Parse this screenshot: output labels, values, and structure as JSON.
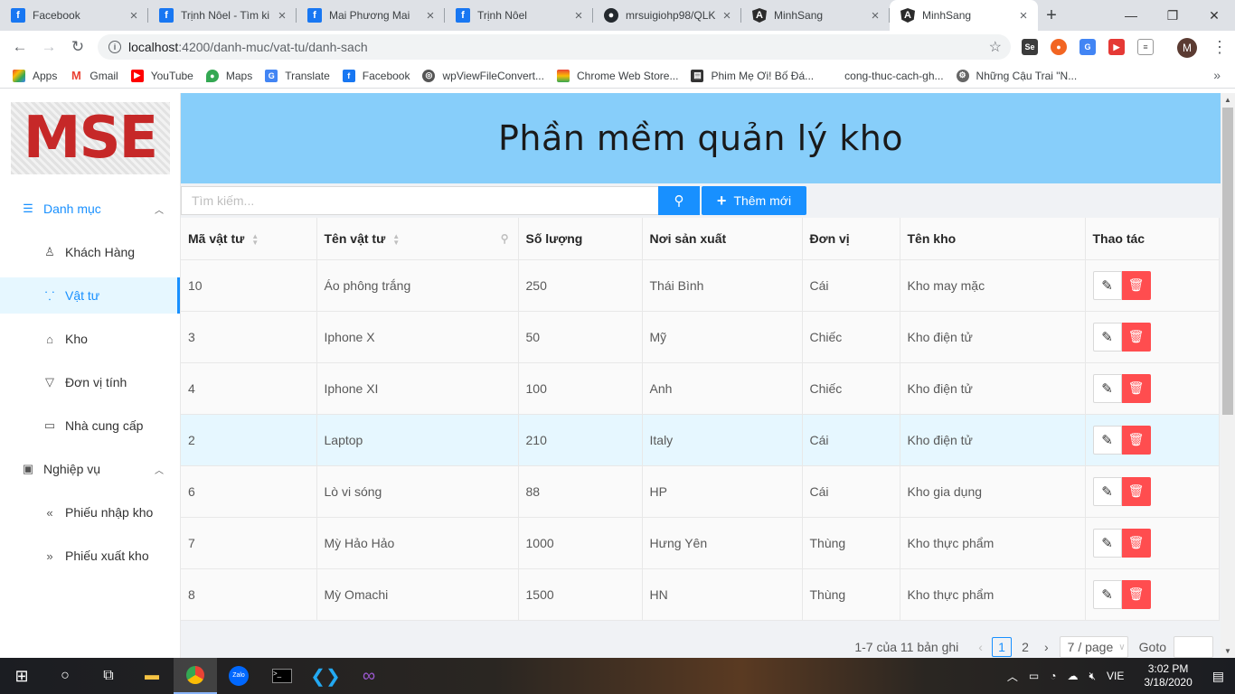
{
  "browser": {
    "tabs": [
      {
        "title": "Facebook",
        "icon": "facebook-icon"
      },
      {
        "title": "Trịnh Nôel - Tìm ki",
        "icon": "facebook-icon"
      },
      {
        "title": "Mai Phương Mai",
        "icon": "facebook-icon"
      },
      {
        "title": "Trịnh Nôel",
        "icon": "facebook-icon"
      },
      {
        "title": "mrsuigiohp98/QLK",
        "icon": "github-icon"
      },
      {
        "title": "MinhSang",
        "icon": "angular-icon"
      },
      {
        "title": "MinhSang",
        "icon": "angular-icon"
      }
    ],
    "url_host": "localhost",
    "url_rest": ":4200/danh-muc/vat-tu/danh-sach",
    "profile_initial": "M",
    "bookmarks": [
      "Apps",
      "Gmail",
      "YouTube",
      "Maps",
      "Translate",
      "Facebook",
      "wpViewFileConvert...",
      "Chrome Web Store...",
      "Phim Mẹ Ơi! Bố Đá...",
      "cong-thuc-cach-gh...",
      "Những Cậu Trai \"N..."
    ]
  },
  "sidebar": {
    "logo": "MSE",
    "groups": [
      {
        "label": "Danh mục",
        "icon": "menu-icon",
        "items": [
          {
            "label": "Khách Hàng",
            "icon": "user-icon"
          },
          {
            "label": "Vật tư",
            "icon": "cluster-icon"
          },
          {
            "label": "Kho",
            "icon": "home-icon"
          },
          {
            "label": "Đơn vị tính",
            "icon": "filter-icon"
          },
          {
            "label": "Nhà cung cấp",
            "icon": "idcard-icon"
          }
        ]
      },
      {
        "label": "Nghiệp vụ",
        "icon": "profile-icon",
        "items": [
          {
            "label": "Phiếu nhập kho",
            "icon": "double-left-icon"
          },
          {
            "label": "Phiếu xuất kho",
            "icon": "double-right-icon"
          }
        ]
      }
    ]
  },
  "header": {
    "title": "Phần mềm quản lý kho"
  },
  "toolbar": {
    "search_placeholder": "Tìm kiếm...",
    "add_label": "Thêm mới"
  },
  "table": {
    "columns": [
      "Mã vật tư",
      "Tên vật tư",
      "Số lượng",
      "Nơi sản xuất",
      "Đơn vị",
      "Tên kho",
      "Thao tác"
    ],
    "rows": [
      [
        "10",
        "Áo phông trắng",
        "250",
        "Thái Bình",
        "Cái",
        "Kho may mặc"
      ],
      [
        "3",
        "Iphone X",
        "50",
        "Mỹ",
        "Chiếc",
        "Kho điện tử"
      ],
      [
        "4",
        "Iphone XI",
        "100",
        "Anh",
        "Chiếc",
        "Kho điện tử"
      ],
      [
        "2",
        "Laptop",
        "210",
        "Italy",
        "Cái",
        "Kho điện tử"
      ],
      [
        "6",
        "Lò vi sóng",
        "88",
        "HP",
        "Cái",
        "Kho gia dụng"
      ],
      [
        "7",
        "Mỳ Hảo Hảo",
        "1000",
        "Hưng Yên",
        "Thùng",
        "Kho thực phẩm"
      ],
      [
        "8",
        "Mỳ Omachi",
        "1500",
        "HN",
        "Thùng",
        "Kho thực phẩm"
      ]
    ]
  },
  "pagination": {
    "total_text": "1-7 của 11 bản ghi",
    "pages": [
      "1",
      "2"
    ],
    "current": "1",
    "page_size": "7 / page",
    "goto_label": "Goto"
  },
  "taskbar": {
    "lang": "VIE",
    "time": "3:02 PM",
    "date": "3/18/2020"
  },
  "colors": {
    "primary": "#1890ff",
    "danger": "#ff4d4f",
    "banner": "#87cefa",
    "logo": "#c62828"
  }
}
